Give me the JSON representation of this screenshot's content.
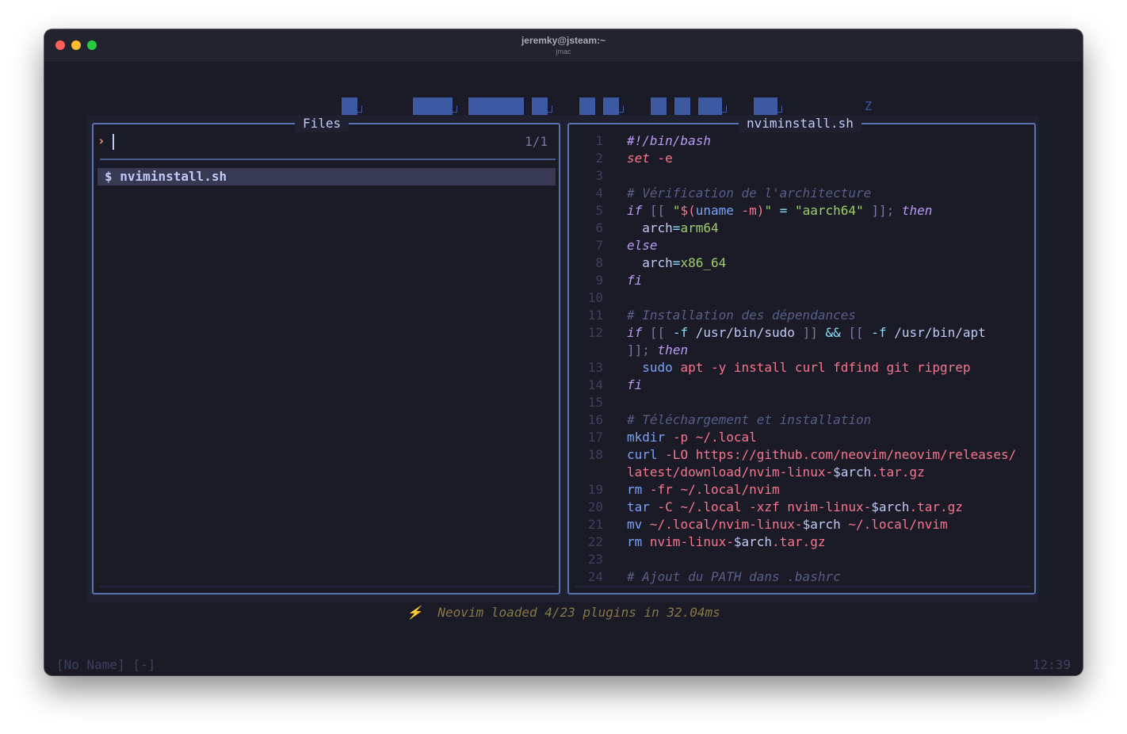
{
  "window": {
    "title": "jeremky@jsteam:~",
    "subtitle": "jmac"
  },
  "background": {
    "z_letter": "Z"
  },
  "files_panel": {
    "title": "Files",
    "prompt_symbol": "›",
    "match_count": "1/1",
    "results": [
      {
        "icon": "$",
        "name": "nviminstall.sh"
      }
    ]
  },
  "preview_panel": {
    "title": "nviminstall.sh",
    "lines": [
      {
        "n": "1",
        "tokens": [
          [
            "shebang",
            "#!/bin/bash"
          ]
        ]
      },
      {
        "n": "2",
        "tokens": [
          [
            "set",
            "set"
          ],
          [
            "txt",
            " "
          ],
          [
            "arg",
            "-e"
          ]
        ]
      },
      {
        "n": "3",
        "tokens": []
      },
      {
        "n": "4",
        "tokens": [
          [
            "cmt",
            "# Vérification de l'architecture"
          ]
        ]
      },
      {
        "n": "5",
        "tokens": [
          [
            "kw",
            "if"
          ],
          [
            "txt",
            " "
          ],
          [
            "punc",
            "[["
          ],
          [
            "txt",
            " "
          ],
          [
            "str",
            "\""
          ],
          [
            "arg",
            "$("
          ],
          [
            "fn",
            "uname"
          ],
          [
            "txt",
            " "
          ],
          [
            "arg",
            "-m)"
          ],
          [
            "str",
            "\""
          ],
          [
            "txt",
            " "
          ],
          [
            "op",
            "="
          ],
          [
            "txt",
            " "
          ],
          [
            "str",
            "\"aarch64\""
          ],
          [
            "txt",
            " "
          ],
          [
            "punc",
            "]];"
          ],
          [
            "txt",
            " "
          ],
          [
            "kw",
            "then"
          ]
        ]
      },
      {
        "n": "6",
        "tokens": [
          [
            "txt",
            "  arch"
          ],
          [
            "op",
            "="
          ],
          [
            "str",
            "arm64"
          ]
        ]
      },
      {
        "n": "7",
        "tokens": [
          [
            "kw",
            "else"
          ]
        ]
      },
      {
        "n": "8",
        "tokens": [
          [
            "txt",
            "  arch"
          ],
          [
            "op",
            "="
          ],
          [
            "str",
            "x86_64"
          ]
        ]
      },
      {
        "n": "9",
        "tokens": [
          [
            "kw",
            "fi"
          ]
        ]
      },
      {
        "n": "10",
        "tokens": []
      },
      {
        "n": "11",
        "tokens": [
          [
            "cmt",
            "# Installation des dépendances"
          ]
        ]
      },
      {
        "n": "12",
        "tokens": [
          [
            "kw",
            "if"
          ],
          [
            "txt",
            " "
          ],
          [
            "punc",
            "[["
          ],
          [
            "txt",
            " "
          ],
          [
            "op",
            "-f"
          ],
          [
            "txt",
            " /usr/bin/sudo "
          ],
          [
            "punc",
            "]]"
          ],
          [
            "txt",
            " "
          ],
          [
            "op",
            "&&"
          ],
          [
            "txt",
            " "
          ],
          [
            "punc",
            "[["
          ],
          [
            "txt",
            " "
          ],
          [
            "op",
            "-f"
          ],
          [
            "txt",
            " /usr/bin/apt"
          ]
        ]
      },
      {
        "n": "",
        "tokens": [
          [
            "punc",
            "]];"
          ],
          [
            "txt",
            " "
          ],
          [
            "kw",
            "then"
          ]
        ]
      },
      {
        "n": "13",
        "tokens": [
          [
            "txt",
            "  "
          ],
          [
            "fn",
            "sudo"
          ],
          [
            "txt",
            " "
          ],
          [
            "arg",
            "apt -y install curl fdfind git ripgrep"
          ]
        ]
      },
      {
        "n": "14",
        "tokens": [
          [
            "kw",
            "fi"
          ]
        ]
      },
      {
        "n": "15",
        "tokens": []
      },
      {
        "n": "16",
        "tokens": [
          [
            "cmt",
            "# Téléchargement et installation"
          ]
        ]
      },
      {
        "n": "17",
        "tokens": [
          [
            "fn",
            "mkdir"
          ],
          [
            "txt",
            " "
          ],
          [
            "arg",
            "-p ~/.local"
          ]
        ]
      },
      {
        "n": "18",
        "tokens": [
          [
            "fn",
            "curl"
          ],
          [
            "txt",
            " "
          ],
          [
            "arg",
            "-LO https://github.com/neovim/neovim/releases/"
          ]
        ]
      },
      {
        "n": "",
        "tokens": [
          [
            "arg",
            "latest/download/nvim-linux-"
          ],
          [
            "var",
            "$arch"
          ],
          [
            "arg",
            ".tar.gz"
          ]
        ]
      },
      {
        "n": "19",
        "tokens": [
          [
            "fn",
            "rm"
          ],
          [
            "txt",
            " "
          ],
          [
            "arg",
            "-fr ~/.local/nvim"
          ]
        ]
      },
      {
        "n": "20",
        "tokens": [
          [
            "fn",
            "tar"
          ],
          [
            "txt",
            " "
          ],
          [
            "arg",
            "-C ~/.local -xzf nvim-linux-"
          ],
          [
            "var",
            "$arch"
          ],
          [
            "arg",
            ".tar.gz"
          ]
        ]
      },
      {
        "n": "21",
        "tokens": [
          [
            "fn",
            "mv"
          ],
          [
            "txt",
            " "
          ],
          [
            "arg",
            "~/.local/nvim-linux-"
          ],
          [
            "var",
            "$arch"
          ],
          [
            "arg",
            " ~/.local/nvim"
          ]
        ]
      },
      {
        "n": "22",
        "tokens": [
          [
            "fn",
            "rm"
          ],
          [
            "txt",
            " "
          ],
          [
            "arg",
            "nvim-linux-"
          ],
          [
            "var",
            "$arch"
          ],
          [
            "arg",
            ".tar.gz"
          ]
        ]
      },
      {
        "n": "23",
        "tokens": []
      },
      {
        "n": "24",
        "tokens": [
          [
            "cmt",
            "# Ajout du PATH dans .bashrc"
          ]
        ]
      }
    ]
  },
  "status_message": {
    "icon": "⚡",
    "text": "Neovim loaded 4/23 plugins in 32.04ms"
  },
  "statusline": {
    "left": "[No Name] [-]",
    "right": "12:39"
  }
}
